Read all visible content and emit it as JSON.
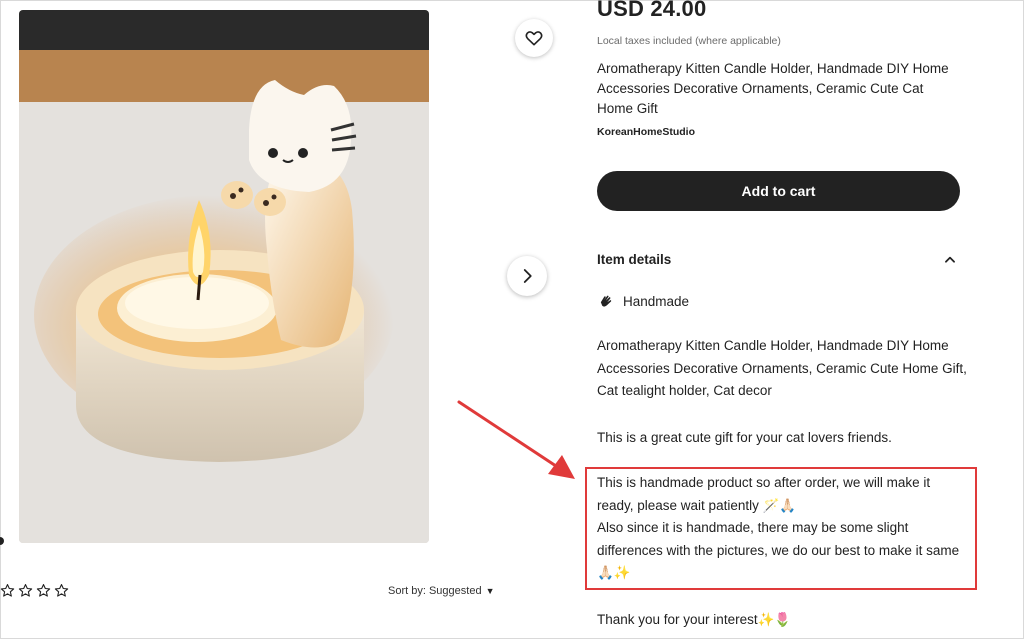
{
  "product": {
    "price": "USD 24.00",
    "tax_note": "Local taxes included (where applicable)",
    "title": "Aromatherapy Kitten Candle Holder, Handmade DIY Home Accessories Decorative Ornaments, Ceramic Cute Cat Home Gift",
    "shop_name": "KoreanHomeStudio",
    "add_to_cart": "Add to cart"
  },
  "item_details": {
    "header": "Item details",
    "handmade_label": "Handmade",
    "description": [
      "Aromatherapy Kitten Candle Holder, Handmade DIY Home Accessories Decorative Ornaments, Ceramic Cute Home Gift, Cat tealight holder, Cat decor",
      "This is a great cute gift for your cat lovers friends.",
      "This is handmade product so after order, we will make it ready, please wait patiently 🪄🙏🏻",
      "Also since it is handmade, there may be some slight differences with the pictures, we do our best to make it same🙏🏻✨",
      "Thank you for your interest✨🌷"
    ]
  },
  "reviews": {
    "rating_stars": 5,
    "sort_label": "Sort by: Suggested"
  },
  "colors": {
    "button_dark": "#222222",
    "highlight_red": "#e03a3a"
  },
  "icons": {
    "favorite": "heart-icon",
    "next": "chevron-right-icon",
    "collapse": "chevron-up-icon",
    "handmade": "hand-icon",
    "sort": "caret-down-icon",
    "star": "star-outline-icon"
  }
}
